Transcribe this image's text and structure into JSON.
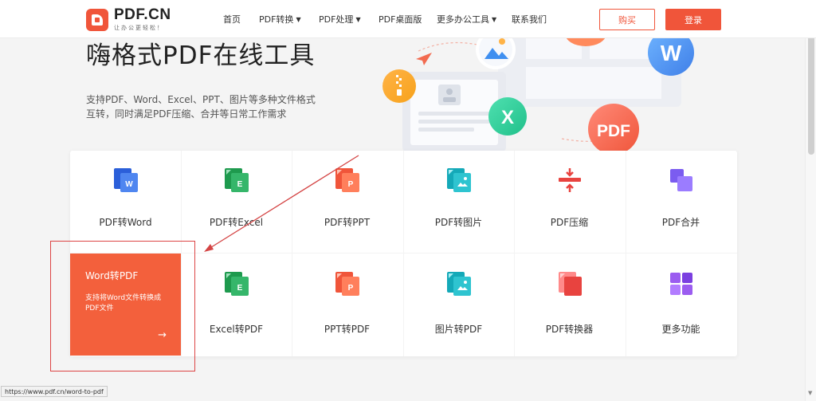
{
  "header": {
    "logo_name": "PDF.CN",
    "logo_slogan": "让办公更轻松！",
    "nav": [
      {
        "label": "首页",
        "dropdown": false
      },
      {
        "label": "PDF转换",
        "dropdown": true
      },
      {
        "label": "PDF处理",
        "dropdown": true
      },
      {
        "label": "PDF桌面版",
        "dropdown": false
      },
      {
        "label": "更多办公工具",
        "dropdown": true
      },
      {
        "label": "联系我们",
        "dropdown": false
      }
    ],
    "caret": "▼",
    "buy_label": "购买",
    "login_label": "登录"
  },
  "hero": {
    "title": "嗨格式PDF在线工具",
    "desc_line1": "支持PDF、Word、Excel、PPT、图片等多种文件格式",
    "desc_line2": "互转，同时满足PDF压缩、合并等日常工作需求",
    "art": {
      "w": "W",
      "x": "X",
      "pdf": "PDF"
    }
  },
  "tools": {
    "row1": [
      {
        "label": "PDF转Word",
        "icon": "word-doc-icon",
        "color": "#2b5fd9"
      },
      {
        "label": "PDF转Excel",
        "icon": "excel-doc-icon",
        "color": "#1e9a4e"
      },
      {
        "label": "PDF转PPT",
        "icon": "ppt-doc-icon",
        "color": "#f0553a"
      },
      {
        "label": "PDF转图片",
        "icon": "image-doc-icon",
        "color": "#14a9b8"
      },
      {
        "label": "PDF压缩",
        "icon": "compress-icon",
        "color": "#e8433f"
      },
      {
        "label": "PDF合并",
        "icon": "merge-icon",
        "color": "#7b5cf0"
      }
    ],
    "featured": {
      "title": "Word转PDF",
      "desc": "支持将Word文件转换成PDF文件",
      "arrow": "→"
    },
    "row2": [
      {
        "label": "Excel转PDF",
        "icon": "excel-doc-icon",
        "color": "#1e9a4e"
      },
      {
        "label": "PPT转PDF",
        "icon": "ppt-doc-icon",
        "color": "#f0553a"
      },
      {
        "label": "图片转PDF",
        "icon": "image-doc-icon",
        "color": "#14a9b8"
      },
      {
        "label": "PDF转换器",
        "icon": "converter-icon",
        "color": "#e8433f"
      },
      {
        "label": "更多功能",
        "icon": "grid-icon",
        "color": "#9b5cf0"
      }
    ]
  },
  "status_url": "https://www.pdf.cn/word-to-pdf",
  "colors": {
    "accent": "#f0553a",
    "annotation": "#d44444"
  }
}
